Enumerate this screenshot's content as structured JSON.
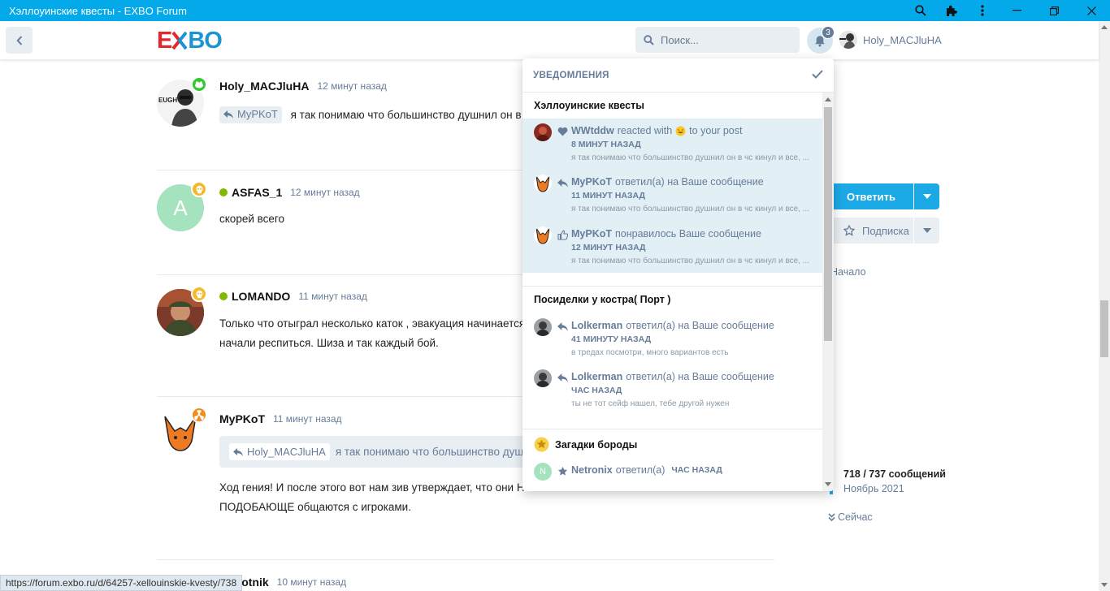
{
  "window": {
    "title": "Хэллоуинские квесты - EXBO Forum"
  },
  "header": {
    "logo_left": "E",
    "logo_right": "BO",
    "search_placeholder": "Поиск...",
    "notif_count": "3",
    "username": "Holy_MACJluHA"
  },
  "posts": [
    {
      "username": "Holy_MACJluHA",
      "time": "12 минут назад",
      "mention": "MyPKoT",
      "text": "я так понимаю что большинство душнил он в чс ки"
    },
    {
      "username": "ASFAS_1",
      "avatar_letter": "A",
      "time": "12 минут назад",
      "text": "скорей всего"
    },
    {
      "username": "LOMANDO",
      "time": "11 минут назад",
      "text_line1": "Только что отыграл несколько каток , эвакуация начинается ещё",
      "text_line2": "начали респиться. Шиза и так каждый бой."
    },
    {
      "username": "MyPKoT",
      "time": "11 минут назад",
      "quote_mention": "Holy_MACJluHA",
      "quote_text": "я так понимаю что большинство душнил",
      "text_line1": "Ход гения! И после этого вот нам зив утверждает, что они НОРМ",
      "text_line2": "ПОДОБАЮЩЕ общаются с игроками."
    },
    {
      "username": "tBolotnik",
      "time": "10 минут назад"
    }
  ],
  "sidebar": {
    "reply_label": "Ответить",
    "subscribe_label": "Подписка",
    "start_label": "Начало",
    "scrub_count": "718 / 737 сообщений",
    "scrub_date": "Ноябрь 2021",
    "now_label": "Сейчас"
  },
  "statusbar": {
    "url": "https://forum.exbo.ru/d/64257-xellouinskie-kvesty/738"
  },
  "notifications": {
    "title": "УВЕДОМЛЕНИЯ",
    "groups": [
      {
        "title": "Хэллоуинские квесты",
        "items": [
          {
            "user": "WWtddw",
            "action": "reacted with",
            "suffix": "to your post",
            "time": "8 минут назад",
            "excerpt": "я так понимаю что большинство душнил он в чс кинул и все, ..."
          },
          {
            "user": "MyPKoT",
            "action": "ответил(а) на Ваше сообщение",
            "time": "11 минут назад",
            "excerpt": "я так понимаю что большинство душнил он в чс кинул и все, ..."
          },
          {
            "user": "MyPKoT",
            "action": "понравилось Ваше сообщение",
            "time": "12 минут назад",
            "excerpt": "я так понимаю что большинство душнил он в чс кинул и все, ..."
          }
        ]
      },
      {
        "title": "Посиделки у костра( Порт )",
        "items": [
          {
            "user": "Lolkerman",
            "action": "ответил(а) на Ваше сообщение",
            "time": "41 минуту назад",
            "excerpt": "в тредах посмотри, много вариантов есть"
          },
          {
            "user": "Lolkerman",
            "action": "ответил(а) на Ваше сообщение",
            "time": "час назад",
            "excerpt": "ты не тот сейф нашел, тебе другой нужен"
          }
        ]
      },
      {
        "title": "Загадки бороды",
        "items": [
          {
            "user": "Netronix",
            "avatar_letter": "N",
            "action": "ответил(а)",
            "time": "час назад"
          }
        ]
      }
    ]
  },
  "colors": {
    "titlebar": "#03a9e9",
    "accent": "#1ba9e6",
    "muted": "#667c99",
    "unread_bg": "#e2eff5",
    "online": "#7fba00"
  }
}
